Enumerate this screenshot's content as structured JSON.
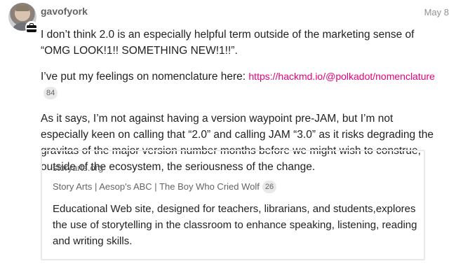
{
  "post": {
    "username": "gavofyork",
    "date": "May 8",
    "paragraphs": {
      "p1": "I don’t think 2.0 is an especially helpful term outside of the marketing sense of “OMG LOOK!1!! SOMETHING NEW!1!!”.",
      "p2_prefix": "I’ve put my feelings on nomenclature here: ",
      "p2_link": "https://hackmd.io/@polkadot/nomenclature",
      "p2_link_clicks": "84",
      "p3": "As it says, I’m not against having a version waypoint pre-JAM, but I’m not especially keen on calling that “2.0” and calling JAM “3.0” as it risks degrading the gravitas of the major version number months before we might wish to construe, outside of the ecosystem, the seriousness of the change."
    }
  },
  "onebox": {
    "source": "storyarts.org",
    "title": "Story Arts | Aesop's ABC | The Boy Who Cried Wolf",
    "title_clicks": "26",
    "description": "Educational Web site, designed for teachers, librarians, and students,explores the use of storytelling in the classroom to enhance speaking, listening, reading and writing skills."
  },
  "colors": {
    "link": "#e6007a",
    "muted": "#646464",
    "badge_bg": "#e9e9e9",
    "border": "#e9e9e9"
  },
  "icons": {
    "user_flair": "briefcase-icon"
  }
}
